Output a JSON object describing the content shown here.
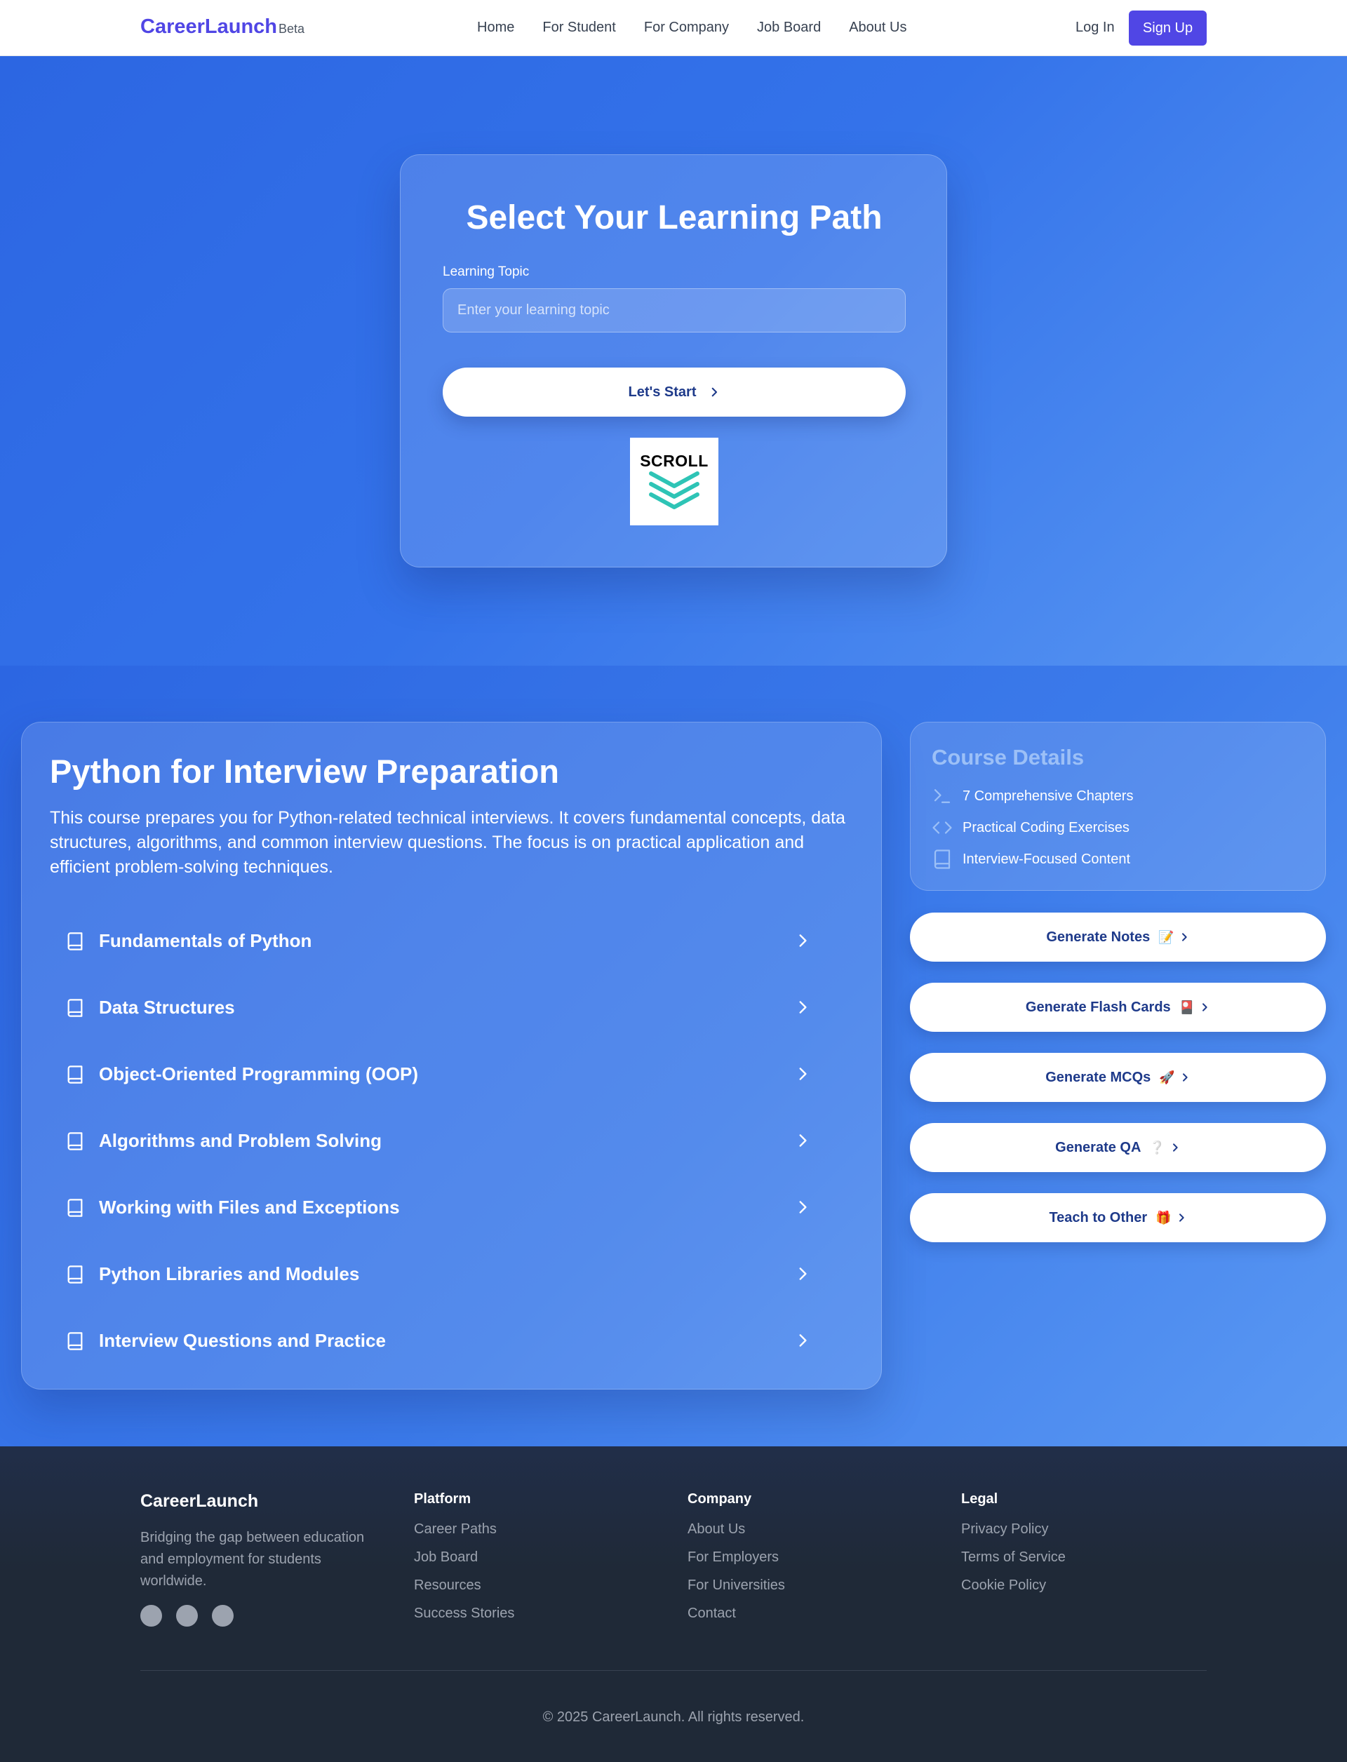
{
  "nav": {
    "brand": "CareerLaunch",
    "badge": "Beta",
    "links": [
      "Home",
      "For Student",
      "For Company",
      "Job Board",
      "About Us"
    ],
    "login": "Log In",
    "signup": "Sign Up"
  },
  "hero": {
    "title": "Select Your Learning Path",
    "topic_label": "Learning Topic",
    "topic_placeholder": "Enter your learning topic",
    "topic_value": "",
    "start_label": "Let's Start",
    "logo_text": "SCROLL"
  },
  "course": {
    "title": "Python for Interview Preparation",
    "description": "This course prepares you for Python-related technical interviews. It covers fundamental concepts, data structures, algorithms, and common interview questions. The focus is on practical application and efficient problem-solving techniques.",
    "chapters": [
      "Fundamentals of Python",
      "Data Structures",
      "Object-Oriented Programming (OOP)",
      "Algorithms and Problem Solving",
      "Working with Files and Exceptions",
      "Python Libraries and Modules",
      "Interview Questions and Practice"
    ]
  },
  "details": {
    "title": "Course Details",
    "items": [
      {
        "icon": "terminal-icon",
        "label": "7 Comprehensive Chapters"
      },
      {
        "icon": "code-icon",
        "label": "Practical Coding Exercises"
      },
      {
        "icon": "book-icon",
        "label": "Interview-Focused Content"
      }
    ]
  },
  "actions": [
    {
      "label": "Generate Notes",
      "emoji": "📝"
    },
    {
      "label": "Generate Flash Cards",
      "emoji": "🎴"
    },
    {
      "label": "Generate MCQs",
      "emoji": "🚀"
    },
    {
      "label": "Generate QA",
      "emoji": "❔"
    },
    {
      "label": "Teach to Other",
      "emoji": "🎁"
    }
  ],
  "footer": {
    "brand": "CareerLaunch",
    "tagline": "Bridging the gap between education and employment for students worldwide.",
    "columns": [
      {
        "title": "Platform",
        "links": [
          "Career Paths",
          "Job Board",
          "Resources",
          "Success Stories"
        ]
      },
      {
        "title": "Company",
        "links": [
          "About Us",
          "For Employers",
          "For Universities",
          "Contact"
        ]
      },
      {
        "title": "Legal",
        "links": [
          "Privacy Policy",
          "Terms of Service",
          "Cookie Policy"
        ]
      }
    ],
    "copyright": "© 2025 CareerLaunch. All rights reserved."
  },
  "colors": {
    "brand": "#5046e5",
    "hero_gradient_start": "#2c66e2",
    "hero_gradient_end": "#5896f2",
    "button_text": "#1e3a8a",
    "footer_bg": "#1f2937"
  }
}
